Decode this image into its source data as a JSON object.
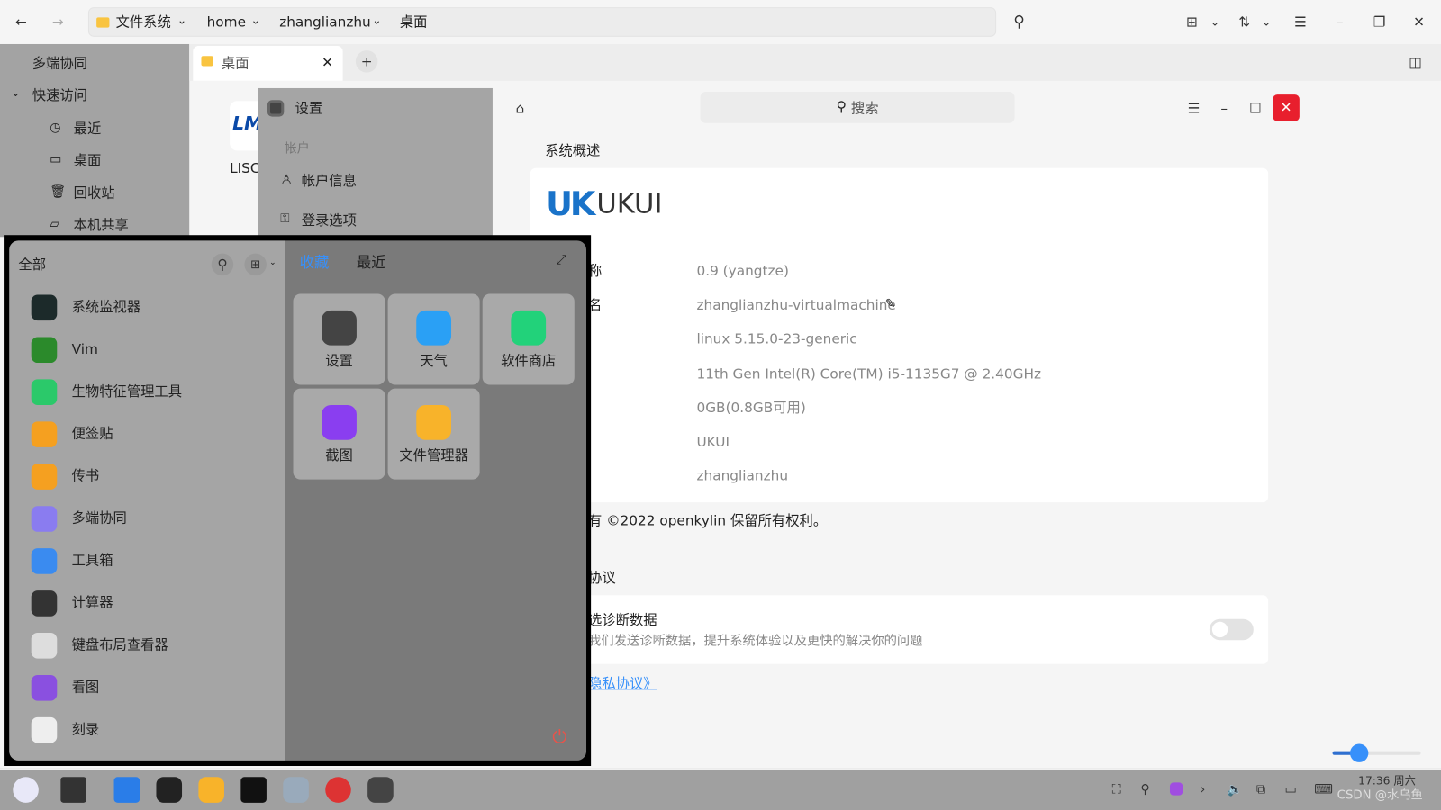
{
  "file_manager": {
    "breadcrumb": [
      "文件系统",
      "home",
      "zhanglianzhu",
      "桌面"
    ],
    "sidebar": {
      "multi": "多端协同",
      "quick_access": "快速访问",
      "items": [
        "最近",
        "桌面",
        "回收站",
        "本机共享"
      ]
    },
    "tab": {
      "label": "桌面"
    },
    "desktop_file": {
      "label": "LISC",
      "logo_text": "LM iMec"
    }
  },
  "settings": {
    "title": "设置",
    "sidebar": {
      "group": "帐户",
      "items": [
        "帐户信息",
        "登录选项"
      ]
    },
    "search_placeholder": "搜索",
    "section_title": "系统概述",
    "logo_text": "UKUI",
    "rows": [
      {
        "label": "称",
        "value": "0.9 (yangtze)"
      },
      {
        "label": "名",
        "value": "zhanglianzhu-virtualmachine"
      },
      {
        "label": "",
        "value": "linux 5.15.0-23-generic"
      },
      {
        "label": "",
        "value": "11th Gen Intel(R) Core(TM) i5-1135G7 @ 2.40GHz"
      },
      {
        "label": "",
        "value": "0GB(0.8GB可用)"
      },
      {
        "label": "",
        "value": "UKUI"
      },
      {
        "label": "",
        "value": "zhanglianzhu"
      }
    ],
    "copyright": "有 ©2022 openkylin 保留所有权利。",
    "agreement_title": "协议",
    "diagnostic_title": "选诊断数据",
    "diagnostic_desc": "我们发送诊断数据，提升系统体验以及更快的解决你的问题",
    "diagnostic_enabled": false,
    "privacy_link": "隐私协议》",
    "slider_value_percent": 30,
    "accent": "#3790fa",
    "close_color": "#e81f2d"
  },
  "start_menu": {
    "all_label": "全部",
    "tabs": [
      "收藏",
      "最近"
    ],
    "apps": [
      "系统监视器",
      "Vim",
      "生物特征管理工具",
      "便签贴",
      "传书",
      "多端协同",
      "工具箱",
      "计算器",
      "键盘布局查看器",
      "看图",
      "刻录"
    ],
    "favorites": [
      "设置",
      "天气",
      "软件商店",
      "截图",
      "文件管理器"
    ]
  },
  "taskbar": {
    "clock": "17:36 周六",
    "watermark": "CSDN @水乌鱼"
  }
}
